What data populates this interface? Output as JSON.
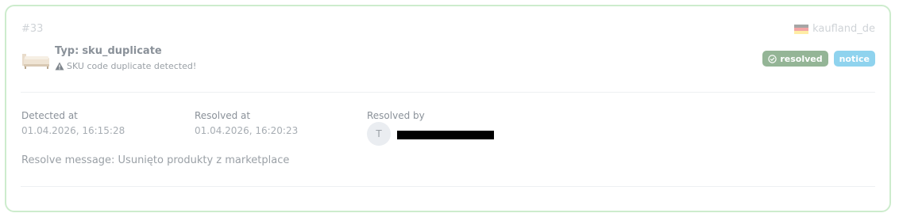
{
  "alert": {
    "id": "#33",
    "marketplace": "kaufland_de",
    "type_label": "Typ:",
    "type_value": "sku_duplicate",
    "message": "SKU code duplicate detected!",
    "badges": {
      "status": "resolved",
      "severity": "notice"
    },
    "colors": {
      "status_badge": "#94b596",
      "severity_badge": "#8fd3ee",
      "card_border": "#cdeccd"
    }
  },
  "details": {
    "detected_at_label": "Detected at",
    "detected_at_value": "01.04.2026, 16:15:28",
    "resolved_at_label": "Resolved at",
    "resolved_at_value": "01.04.2026, 16:20:23",
    "resolved_by_label": "Resolved by",
    "resolved_by_initial": "T",
    "resolve_message": "Resolve message: Usunięto produkty z marketplace"
  }
}
